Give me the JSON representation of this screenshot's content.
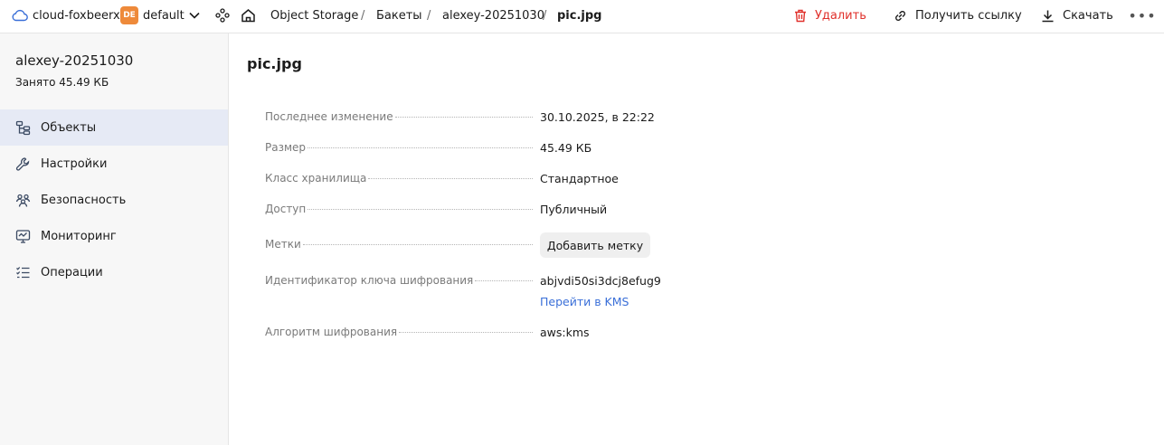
{
  "header": {
    "cloud_name": "cloud-foxbeerx",
    "folder_badge": "DE",
    "folder_name": "default",
    "breadcrumbs": [
      "Object Storage",
      "Бакеты",
      "alexey-20251030",
      "pic.jpg"
    ],
    "separator": "/",
    "actions": {
      "delete": "Удалить",
      "get_link": "Получить ссылку",
      "download": "Скачать",
      "more": "•••"
    }
  },
  "sidebar": {
    "bucket_name": "alexey-20251030",
    "usage": "Занято 45.49 КБ",
    "items": [
      {
        "label": "Объекты",
        "icon": "objects-icon",
        "active": true
      },
      {
        "label": "Настройки",
        "icon": "wrench-icon",
        "active": false
      },
      {
        "label": "Безопасность",
        "icon": "users-icon",
        "active": false
      },
      {
        "label": "Мониторинг",
        "icon": "monitor-icon",
        "active": false
      },
      {
        "label": "Операции",
        "icon": "list-icon",
        "active": false
      }
    ]
  },
  "main": {
    "title": "pic.jpg",
    "properties": [
      {
        "label": "Последнее изменение",
        "value": "30.10.2025, в 22:22"
      },
      {
        "label": "Размер",
        "value": "45.49 КБ"
      },
      {
        "label": "Класс хранилища",
        "value": "Стандартное"
      },
      {
        "label": "Доступ",
        "value": "Публичный"
      },
      {
        "label": "Метки",
        "button": "Добавить метку"
      },
      {
        "label": "Идентификатор ключа шифрования",
        "value": "abjvdi50si3dcj8efug9",
        "link": "Перейти в KMS"
      },
      {
        "label": "Алгоритм шифрования",
        "value": "aws:kms"
      }
    ]
  },
  "colors": {
    "accent": "#3a6fd8",
    "danger": "#e0302b",
    "folder_badge": "#ee8a3a",
    "active_nav": "#e6eaf5"
  }
}
